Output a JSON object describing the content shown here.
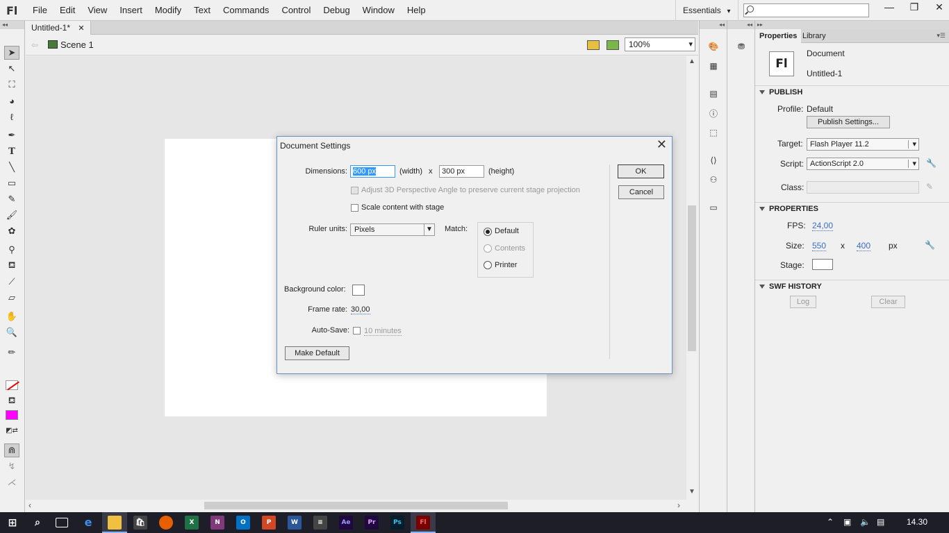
{
  "app": {
    "logo": "Fl",
    "menu": [
      "File",
      "Edit",
      "View",
      "Insert",
      "Modify",
      "Text",
      "Commands",
      "Control",
      "Debug",
      "Window",
      "Help"
    ],
    "workspace": "Essentials",
    "window_buttons": [
      "—",
      "❐",
      "✕"
    ]
  },
  "document": {
    "tab_title": "Untitled-1*",
    "tab_close": "✕",
    "scene": "Scene 1",
    "zoom": "100%"
  },
  "dialog": {
    "title": "Document Settings",
    "close": "✕",
    "dimensions_label": "Dimensions:",
    "width_value": "600 px",
    "width_label": "(width)",
    "x_label": "x",
    "height_value": "300 px",
    "height_label": "(height)",
    "adjust_3d_label": "Adjust 3D Perspective Angle to preserve current stage projection",
    "adjust_3d_checked": false,
    "scale_content_label": "Scale content with stage",
    "scale_content_checked": false,
    "ruler_units_label": "Ruler units:",
    "ruler_units_value": "Pixels",
    "match_label": "Match:",
    "match_options": [
      "Default",
      "Contents",
      "Printer"
    ],
    "match_selected": "Default",
    "background_color_label": "Background color:",
    "background_color": "#ffffff",
    "frame_rate_label": "Frame rate:",
    "frame_rate_value": "30,00",
    "autosave_label": "Auto-Save:",
    "autosave_value": "10 minutes",
    "autosave_checked": false,
    "make_default": "Make Default",
    "ok": "OK",
    "cancel": "Cancel"
  },
  "properties": {
    "tabs": [
      "Properties",
      "Library"
    ],
    "active_tab": "Properties",
    "doc_icon": "Fl",
    "doc_type": "Document",
    "doc_name": "Untitled-1",
    "publish_header": "PUBLISH",
    "profile_label": "Profile:",
    "profile_value": "Default",
    "publish_settings": "Publish Settings...",
    "target_label": "Target:",
    "target_value": "Flash Player 11.2",
    "script_label": "Script:",
    "script_value": "ActionScript 2.0",
    "class_label": "Class:",
    "properties_header": "PROPERTIES",
    "fps_label": "FPS:",
    "fps_value": "24,00",
    "size_label": "Size:",
    "size_w": "550",
    "size_x": "x",
    "size_h": "400",
    "size_unit": "px",
    "stage_label": "Stage:",
    "stage_color": "#ffffff",
    "swf_history_header": "SWF HISTORY",
    "log": "Log",
    "clear": "Clear"
  },
  "colors": {
    "fill_color": "#ff00ff",
    "stroke_color": "none",
    "stage_color": "#ffffff",
    "pasteboard": "#e6e6e6"
  },
  "taskbar": {
    "icons": [
      "start-icon",
      "search-icon",
      "task-view-icon",
      "edge-icon",
      "file-explorer-icon",
      "store-icon",
      "firefox-icon",
      "excel-icon",
      "onenote-icon",
      "outlook-icon",
      "powerpoint-icon",
      "word-icon",
      "app-icon",
      "after-effects-icon",
      "premiere-icon",
      "photoshop-icon",
      "flash-icon"
    ],
    "time": "14.30"
  }
}
